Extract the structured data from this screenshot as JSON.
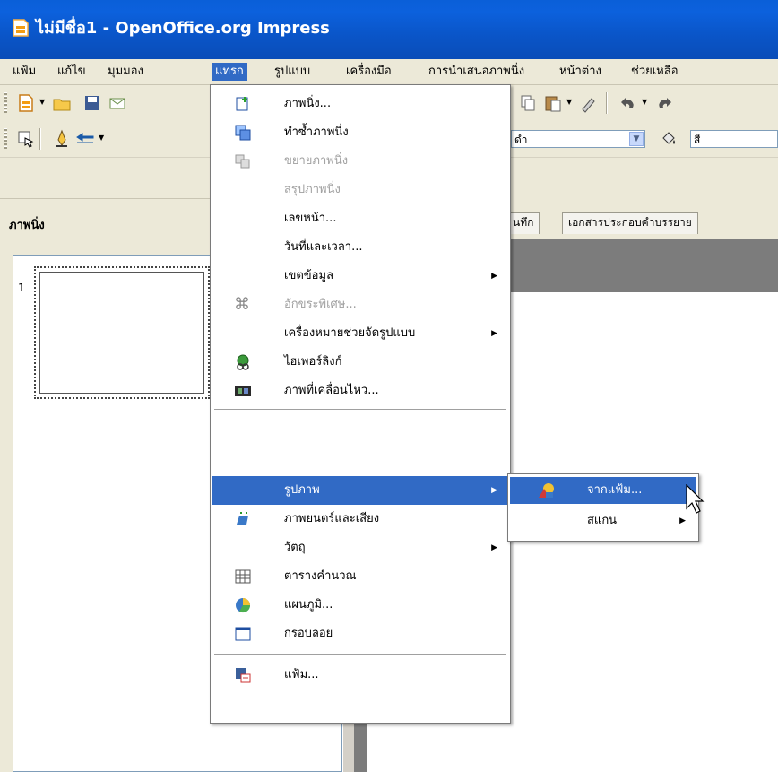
{
  "window": {
    "title": "ไม่มีชื่อ1 - OpenOffice.org Impress"
  },
  "menubar": {
    "items": [
      {
        "label": "แฟ้ม"
      },
      {
        "label": "แก้ไข"
      },
      {
        "label": "มุมมอง"
      },
      {
        "label": "แทรก"
      },
      {
        "label": "รูปแบบ"
      },
      {
        "label": "เครื่องมือ"
      },
      {
        "label": "การนำเสนอภาพนิ่ง"
      },
      {
        "label": "หน้าต่าง"
      },
      {
        "label": "ช่วยเหลือ"
      }
    ]
  },
  "toolbar2": {
    "line_color_value": "ดำ",
    "fill_value": "สี"
  },
  "slides_panel": {
    "title": "ภาพนิ่ง",
    "slide_number": "1"
  },
  "view_tabs": [
    {
      "label": "นทึก"
    },
    {
      "label": "เอกสารประกอบคำบรรยาย"
    }
  ],
  "insert_menu": {
    "items": [
      {
        "label": "ภาพนิ่ง...",
        "icon": "new-slide-icon",
        "disabled": false
      },
      {
        "label": "ทำซ้ำภาพนิ่ง",
        "icon": "duplicate-slide-icon",
        "disabled": false
      },
      {
        "label": "ขยายภาพนิ่ง",
        "icon": "expand-slide-icon",
        "disabled": true
      },
      {
        "label": "สรุปภาพนิ่ง",
        "icon": "",
        "disabled": true
      },
      {
        "label": "เลขหน้า...",
        "icon": "",
        "disabled": false
      },
      {
        "label": "วันที่และเวลา...",
        "icon": "",
        "disabled": false
      },
      {
        "label": "เขตข้อมูล",
        "icon": "",
        "disabled": false,
        "submenu": true
      },
      {
        "label": "อักขระพิเศษ...",
        "icon": "special-character-icon",
        "disabled": true
      },
      {
        "label": "เครื่องหมายช่วยจัดรูปแบบ",
        "icon": "",
        "disabled": false,
        "submenu": true
      },
      {
        "label": "ไฮเพอร์ลิงก์",
        "icon": "hyperlink-icon",
        "disabled": false
      },
      {
        "label": "ภาพที่เคลื่อนไหว...",
        "icon": "animated-image-icon",
        "disabled": false
      },
      {
        "label": "รูปภาพ",
        "icon": "",
        "disabled": false,
        "submenu": true,
        "highlighted": true
      },
      {
        "label": "ภาพยนตร์และเสียง",
        "icon": "movie-sound-icon",
        "disabled": false
      },
      {
        "label": "วัตถุ",
        "icon": "",
        "disabled": false,
        "submenu": true
      },
      {
        "label": "ตารางคำนวณ",
        "icon": "spreadsheet-icon",
        "disabled": false
      },
      {
        "label": "แผนภูมิ...",
        "icon": "chart-icon",
        "disabled": false
      },
      {
        "label": "กรอบลอย",
        "icon": "floating-frame-icon",
        "disabled": false
      },
      {
        "label": "แฟ้ม...",
        "icon": "insert-file-icon",
        "disabled": false
      }
    ]
  },
  "picture_submenu": {
    "items": [
      {
        "label": "จากแฟ้ม...",
        "icon": "picture-from-file-icon",
        "highlighted": true
      },
      {
        "label": "สแกน",
        "submenu": true
      }
    ]
  }
}
